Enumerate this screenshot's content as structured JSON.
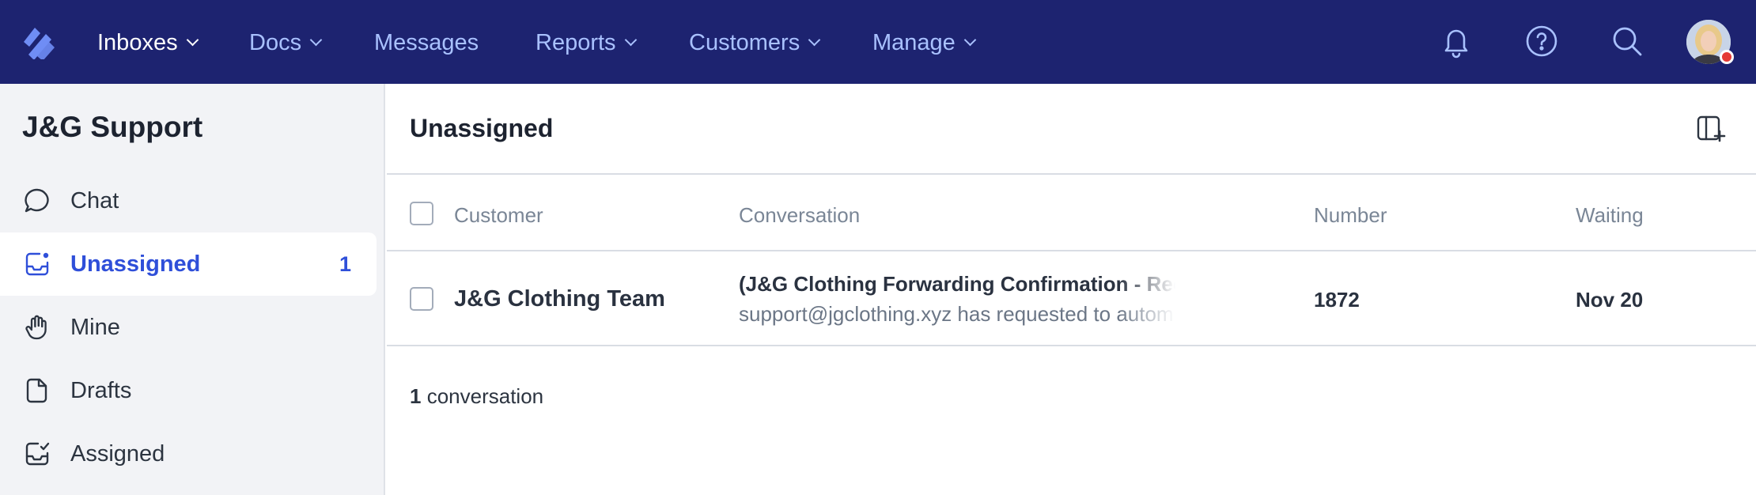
{
  "nav": {
    "items": [
      {
        "label": "Inboxes",
        "dropdown": true,
        "active": true
      },
      {
        "label": "Docs",
        "dropdown": true,
        "active": false
      },
      {
        "label": "Messages",
        "dropdown": false,
        "active": false
      },
      {
        "label": "Reports",
        "dropdown": true,
        "active": false
      },
      {
        "label": "Customers",
        "dropdown": true,
        "active": false
      },
      {
        "label": "Manage",
        "dropdown": true,
        "active": false
      }
    ],
    "icons": [
      "bell-icon",
      "help-icon",
      "search-icon",
      "avatar"
    ],
    "colors": {
      "background": "#1d2370",
      "link": "#a9c1ff",
      "active": "#ffffff",
      "status_badge": "#e53935"
    }
  },
  "sidebar": {
    "title": "J&G Support",
    "items": [
      {
        "label": "Chat",
        "icon": "chat-bubble-icon",
        "count": ""
      },
      {
        "label": "Unassigned",
        "icon": "inbox-unassigned-icon",
        "count": "1",
        "active": true
      },
      {
        "label": "Mine",
        "icon": "raised-hand-icon",
        "count": ""
      },
      {
        "label": "Drafts",
        "icon": "draft-document-icon",
        "count": ""
      },
      {
        "label": "Assigned",
        "icon": "inbox-check-icon",
        "count": ""
      }
    ],
    "colors": {
      "background": "#f2f3f6",
      "active_text": "#2f4fd9"
    }
  },
  "main": {
    "title": "Unassigned",
    "columns": [
      "Customer",
      "Conversation",
      "Number",
      "Waiting"
    ],
    "rows": [
      {
        "customer": "J&G Clothing Team",
        "subject": "(J&G Clothing Forwarding Confirmation - Rece",
        "preview": "support@jgclothing.xyz has requested to autom",
        "number": "1872",
        "waiting": "Nov 20"
      }
    ],
    "count_number": "1",
    "count_label": " conversation"
  }
}
